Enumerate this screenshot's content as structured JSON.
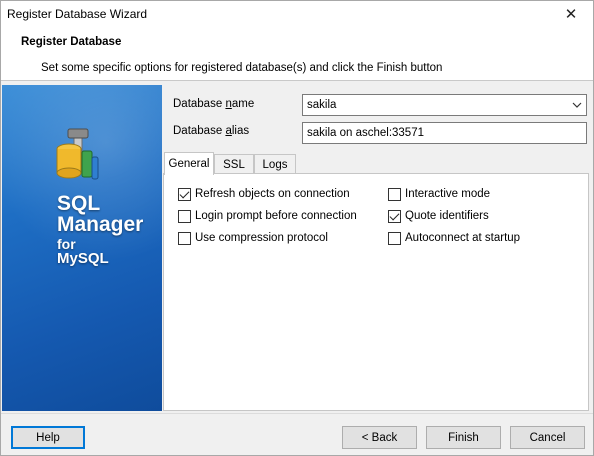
{
  "window": {
    "title": "Register Database Wizard",
    "close_glyph": "✕"
  },
  "header": {
    "title": "Register Database",
    "subtitle": "Set some specific options for registered database(s) and click the Finish button"
  },
  "banner": {
    "logo_icon": "database-tools-icon",
    "line1": "SQL",
    "line2": "Manager",
    "line3": "for",
    "line4": "MySQL"
  },
  "form": {
    "db_name_label_pre": "Database ",
    "db_name_label_u": "n",
    "db_name_label_post": "ame",
    "db_name_value": "sakila",
    "db_alias_label_pre": "Database ",
    "db_alias_label_u": "a",
    "db_alias_label_post": "lias",
    "db_alias_value": "sakila on aschel:33571",
    "combo_arrow": "⌵"
  },
  "tabs": [
    {
      "label": "General",
      "active": true
    },
    {
      "label": "SSL",
      "active": false
    },
    {
      "label": "Logs",
      "active": false
    }
  ],
  "options": {
    "refresh": {
      "label": "Refresh objects on connection",
      "checked": true
    },
    "interactive": {
      "label": "Interactive mode",
      "checked": false
    },
    "login_prompt": {
      "label": "Login prompt before connection",
      "checked": false
    },
    "quote": {
      "label": "Quote identifiers",
      "checked": true
    },
    "compression": {
      "label": "Use compression protocol",
      "checked": false
    },
    "autoconnect": {
      "label": "Autoconnect at startup",
      "checked": false
    }
  },
  "footer": {
    "help": "Help",
    "back": "< Back",
    "finish": "Finish",
    "cancel": "Cancel"
  },
  "colors": {
    "banner_blue": "#1e6ec4",
    "focus_blue": "#0078d7"
  }
}
